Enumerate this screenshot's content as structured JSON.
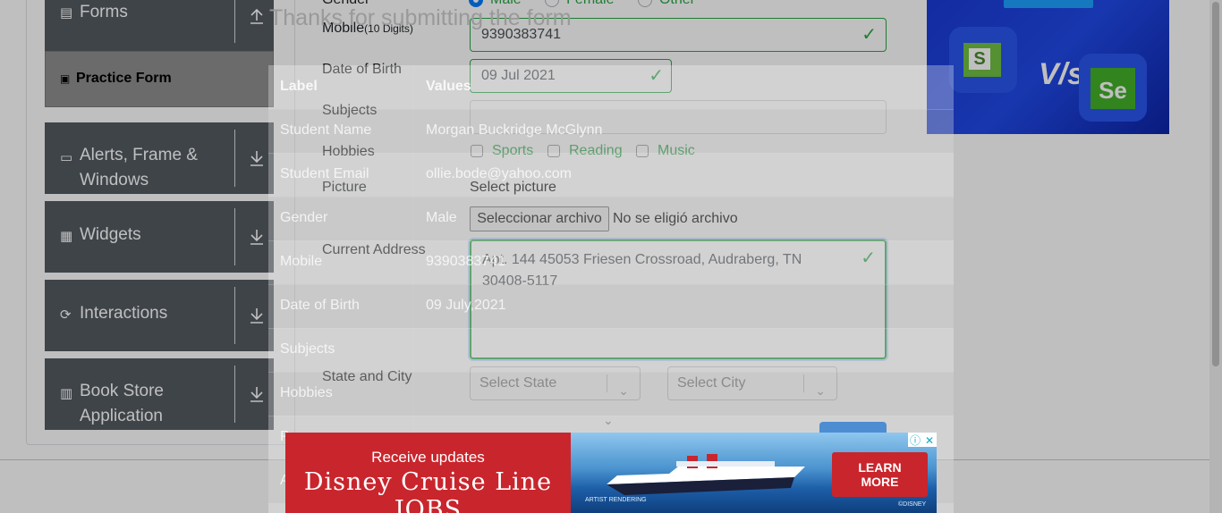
{
  "sidebar": {
    "forms_label": "Forms",
    "practice_form_label": "Practice Form",
    "alerts_label_line1": "Alerts, Frame &",
    "alerts_label_line2": "Windows",
    "widgets_label": "Widgets",
    "interactions_label": "Interactions",
    "bookstore_label_line1": "Book Store",
    "bookstore_label_line2": "Application"
  },
  "form": {
    "gender_label": "Gender",
    "gender_options": [
      "Male",
      "Female",
      "Other"
    ],
    "mobile_label": "Mobile",
    "mobile_hint": "(10 Digits)",
    "mobile_value": "9390383741",
    "dob_label": "Date of Birth",
    "dob_value": "09 Jul 2021",
    "subjects_label": "Subjects",
    "hobbies_label": "Hobbies",
    "hobbies": [
      "Sports",
      "Reading",
      "Music"
    ],
    "picture_label": "Picture",
    "select_picture": "Select picture",
    "file_button": "Seleccionar archivo",
    "file_status": "No se eligió archivo",
    "address_label": "Current Address",
    "address_value": "Apt. 144 45053 Friesen Crossroad, Audraberg, TN 30408-5117",
    "state_city_label": "State and City",
    "state_placeholder": "Select State",
    "city_placeholder": "Select City"
  },
  "modal": {
    "title": "Thanks for submitting the form",
    "col_label": "Label",
    "col_values": "Values",
    "rows": [
      {
        "label": "Student Name",
        "value": "Morgan Buckridge McGlynn"
      },
      {
        "label": "Student Email",
        "value": "ollie.bode@yahoo.com"
      },
      {
        "label": "Gender",
        "value": "Male"
      },
      {
        "label": "Mobile",
        "value": "9390383741"
      },
      {
        "label": "Date of Birth",
        "value": "09 July,2021"
      },
      {
        "label": "Subjects",
        "value": ""
      },
      {
        "label": "Hobbies",
        "value": ""
      },
      {
        "label": "P",
        "value": ""
      },
      {
        "label": "A",
        "value": ""
      }
    ]
  },
  "ad_bottom": {
    "line1": "Receive updates",
    "line2": "Disney Cruise Line JOBS",
    "cta_line1": "LEARN",
    "cta_line2": "MORE",
    "fine1": "ARTIST RENDERING",
    "fine2": "©DISNEY"
  },
  "ad_right": {
    "vs_text": "V/s"
  },
  "colors": {
    "sidebar_bg": "#545b62",
    "valid_green": "#28a745",
    "primary_blue": "#007bff",
    "ad_red": "#c9252c"
  }
}
